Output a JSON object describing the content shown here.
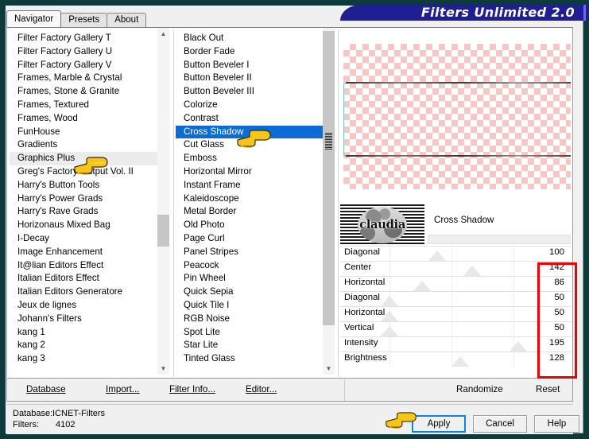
{
  "window": {
    "title": "Filters Unlimited 2.0",
    "border_color": "#0d3b3b",
    "title_bg": "#1f1f93"
  },
  "tabs": [
    {
      "label": "Navigator",
      "active": true
    },
    {
      "label": "Presets",
      "active": false
    },
    {
      "label": "About",
      "active": false
    }
  ],
  "categories": {
    "items": [
      "Filter Factory Gallery T",
      "Filter Factory Gallery U",
      "Filter Factory Gallery V",
      "Frames, Marble & Crystal",
      "Frames, Stone & Granite",
      "Frames, Textured",
      "Frames, Wood",
      "FunHouse",
      "Gradients",
      "Graphics Plus",
      "Greg's Factory Output Vol. II",
      "Harry's Button Tools",
      "Harry's Power Grads",
      "Harry's Rave Grads",
      "Horizonaus Mixed Bag",
      "I-Decay",
      "Image Enhancement",
      "It@lian Editors Effect",
      "Italian Editors Effect",
      "Italian Editors Generatore",
      "Jeux de lignes",
      "Johann's Filters",
      "kang 1",
      "kang 2",
      "kang 3"
    ],
    "hovered": "Graphics Plus"
  },
  "filters": {
    "items": [
      "Black Out",
      "Border Fade",
      "Button Beveler I",
      "Button Beveler II",
      "Button Beveler III",
      "Colorize",
      "Contrast",
      "Cross Shadow",
      "Cut Glass",
      "Emboss",
      "Horizontal Mirror",
      "Instant Frame",
      "Kaleidoscope",
      "Metal Border",
      "Old Photo",
      "Page Curl",
      "Panel Stripes",
      "Peacock",
      "Pin Wheel",
      "Quick Sepia",
      "Quick Tile I",
      "RGB Noise",
      "Spot Lite",
      "Star Lite",
      "Tinted Glass"
    ],
    "selected": "Cross Shadow"
  },
  "preview": {
    "logo_text": "claudia",
    "filter_title": "Cross Shadow"
  },
  "sliders": [
    {
      "label": "Diagonal",
      "value": "100",
      "knob_pct": 46
    },
    {
      "label": "Center",
      "value": "142",
      "knob_pct": 64
    },
    {
      "label": "Horizontal",
      "value": "86",
      "knob_pct": 38
    },
    {
      "label": "Diagonal",
      "value": "50",
      "knob_pct": 21
    },
    {
      "label": "Horizontal",
      "value": "50",
      "knob_pct": 21
    },
    {
      "label": "Vertical",
      "value": "50",
      "knob_pct": 21
    },
    {
      "label": "Intensity",
      "value": "195",
      "knob_pct": 88
    },
    {
      "label": "Brightness",
      "value": "128",
      "knob_pct": 58
    }
  ],
  "actions": {
    "database": "Database",
    "import": "Import...",
    "filter_info": "Filter Info...",
    "editor": "Editor...",
    "randomize": "Randomize",
    "reset": "Reset"
  },
  "status": {
    "database_label": "Database:",
    "database_value": "ICNET-Filters",
    "filters_label": "Filters:",
    "filters_value": "4102"
  },
  "buttons": {
    "apply": "Apply",
    "cancel": "Cancel",
    "help": "Help"
  },
  "highlight": {
    "box_color": "#ef0000"
  }
}
